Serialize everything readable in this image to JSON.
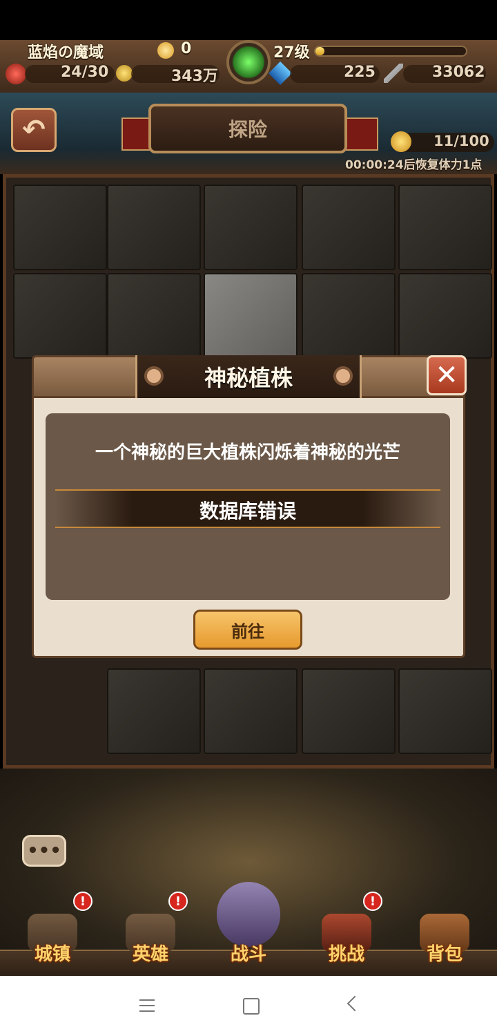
{
  "hud": {
    "area_name": "蓝焰の魔域",
    "vip_value": "0",
    "level": "27级",
    "level_progress": 0.06,
    "stamina_item": "24/30",
    "gold": "343万",
    "gems": "225",
    "power": "33062"
  },
  "header": {
    "title": "探险",
    "stamina": "11/100",
    "recover_text": "00:00:24后恢复体力1点"
  },
  "dialog": {
    "title": "神秘植株",
    "message": "一个神秘的巨大植株闪烁着神秘的光芒",
    "error": "数据库错误",
    "go_button": "前往",
    "close_icon": "close-icon"
  },
  "bottom_nav": [
    {
      "label": "城镇",
      "alert": "!"
    },
    {
      "label": "英雄",
      "alert": "!"
    },
    {
      "label": "战斗",
      "alert": ""
    },
    {
      "label": "挑战",
      "alert": "!"
    },
    {
      "label": "背包",
      "alert": ""
    }
  ],
  "chat_label": "•••",
  "android_nav": {
    "menu": "menu-icon",
    "home": "home-icon",
    "back": "back-icon"
  },
  "colors": {
    "accent": "#e69a2e",
    "panel": "#6b5848",
    "alert": "#d6261e"
  }
}
